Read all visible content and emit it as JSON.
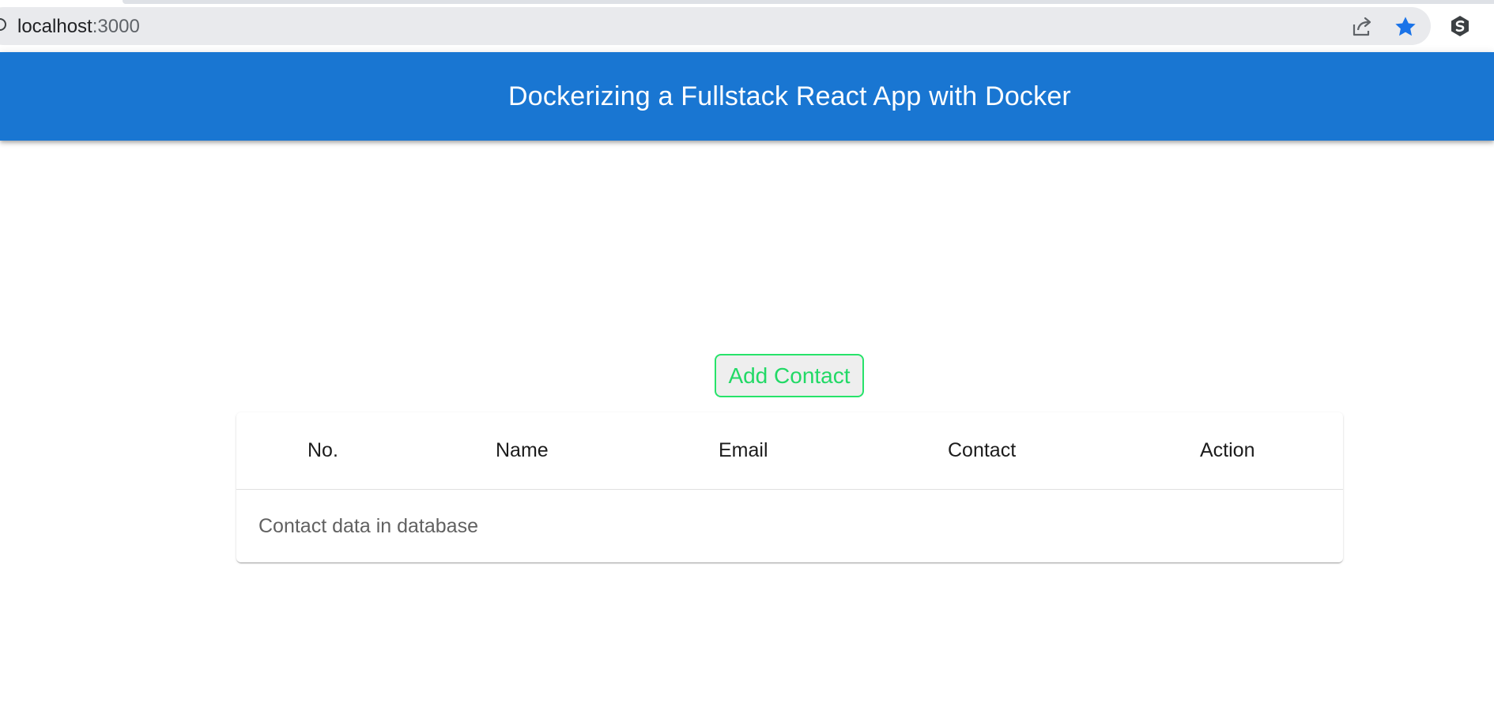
{
  "browser": {
    "url_host": "localhost",
    "url_port": ":3000",
    "icons": [
      "info-icon",
      "share-icon",
      "bookmark-star-icon",
      "extension-icon"
    ],
    "accent_color": "#1a73e8"
  },
  "header": {
    "title": "Dockerizing a Fullstack React App with Docker",
    "background_color": "#1976d2"
  },
  "actions": {
    "add_contact_label": "Add Contact",
    "add_contact_color": "#22d966"
  },
  "table": {
    "columns": [
      "No.",
      "Name",
      "Email",
      "Contact",
      "Action"
    ],
    "empty_message": "Contact data in database"
  }
}
